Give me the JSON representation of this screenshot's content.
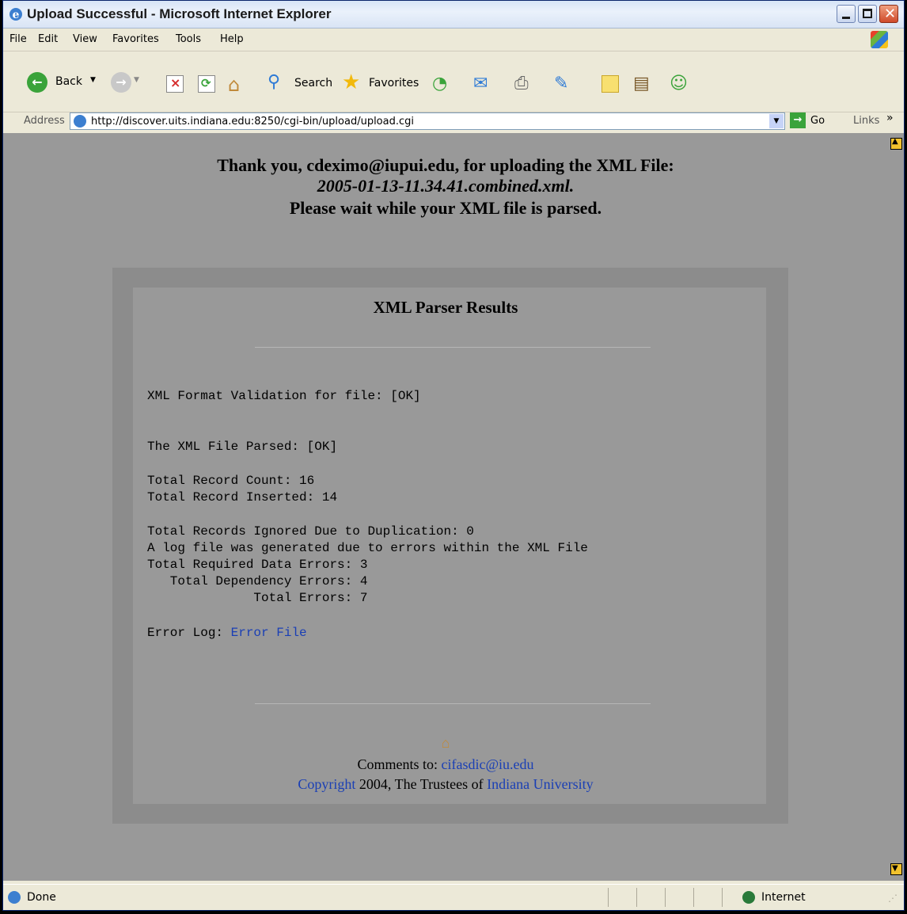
{
  "window": {
    "title": "Upload Successful - Microsoft Internet Explorer"
  },
  "menu": [
    "File",
    "Edit",
    "View",
    "Favorites",
    "Tools",
    "Help"
  ],
  "toolbar": {
    "back": "Back",
    "search": "Search",
    "favorites": "Favorites"
  },
  "address": {
    "label": "Address",
    "url": "http://discover.uits.indiana.edu:8250/cgi-bin/upload/upload.cgi",
    "go": "Go",
    "links": "Links"
  },
  "page": {
    "thanks_line": "Thank you, cdeximo@iupui.edu, for uploading the XML File:",
    "file_name": "2005-01-13-11.34.41.combined.xml.",
    "wait_line": "Please wait while your XML file is parsed.",
    "results_title": "XML Parser Results",
    "validation": "XML Format Validation for file: [OK]",
    "parsed": "The XML File Parsed: [OK]",
    "record_count": "Total Record Count: 16",
    "record_inserted": "Total Record Inserted: 14",
    "ignored": "Total Records Ignored Due to Duplication: 0",
    "log_note": "A log file was generated due to errors within the XML File",
    "required_errors": "Total Required Data Errors: 3",
    "dependency_errors": "   Total Dependency Errors: 4",
    "total_errors": "              Total Errors: 7",
    "error_log_label": "Error Log: ",
    "error_log_link": "Error File",
    "comments_label": "Comments to: ",
    "comments_email": "cifasdic@iu.edu",
    "copyright_link": "Copyright",
    "copyright_text": " 2004, The Trustees of ",
    "university_link": "Indiana University"
  },
  "status": {
    "text": "Done",
    "zone": "Internet"
  }
}
